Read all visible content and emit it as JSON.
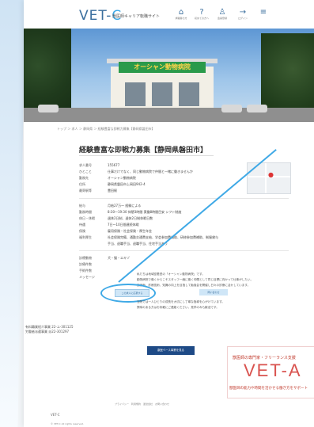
{
  "header": {
    "logo_main": "VET-",
    "logo_accent": "C",
    "logo_sub": "獣医師キャリア転職サイト",
    "nav": [
      {
        "glyph": "⌂",
        "label": "求職者の方"
      },
      {
        "glyph": "?",
        "label": "初めての方へ"
      },
      {
        "glyph": "♙",
        "label": "会員登録"
      },
      {
        "glyph": "→",
        "label": "ログイン"
      },
      {
        "glyph": "≡",
        "label": ""
      }
    ]
  },
  "hero": {
    "store_sign": "オーシャン動物病院"
  },
  "breadcrumb": "トップ ＞ 求人 ＞ 静岡県 ＞ 経験豊富な即戦力募集【静岡県磐田市】",
  "job": {
    "title": "経験豊富な即戦力募集【静岡県磐田市】",
    "info1": [
      {
        "key": "求人番号",
        "value": "155677"
      },
      {
        "key": "ひとこと",
        "value": "仕事だけでなく、同じ動物病院で仲間と一緒に働きませんか"
      },
      {
        "key": "勤務先",
        "value": "オーシャン動物病院"
      },
      {
        "key": "住所",
        "value": "静岡県磐田市上岡田942-4"
      },
      {
        "key": "最寄駅等",
        "value": "豊田駅"
      }
    ],
    "info2": [
      {
        "key": "給与",
        "value": "月給27万〜 経験による"
      },
      {
        "key": "勤務時間",
        "value": "8:30〜19:30 休憩3時間 実働8時間目安 シフト制度"
      },
      {
        "key": "休日・休暇",
        "value": "週休2日制、週休2日制休暇日数"
      },
      {
        "key": "待遇",
        "value": "7日〜10日間連続休暇"
      },
      {
        "key": "保険",
        "value": "雇用保険・社会保険・厚生年金"
      },
      {
        "key": "福利厚生",
        "value": "社会保険完備、通勤交通費支給、学会参加費補助、研修参加費補助、制服貸与"
      },
      {
        "key": "",
        "value": "手当、退職手当、退職手当、住宅手当あり"
      }
    ],
    "info3": [
      {
        "key": "診療動物",
        "value": "犬・猫・エキゾ"
      },
      {
        "key": "診療件数",
        "value": ""
      },
      {
        "key": "手術件数",
        "value": ""
      },
      {
        "key": "メッセージ",
        "value": ""
      }
    ],
    "message": [
      "私たちは地域密着型の「オーシャン動物病院」です。",
      "動物病院で働くからこそスタッフ一緒に働く仲間として同じ目標に向かって仕事がしたい。",
      "技術面、診療技術、知識の向上を目指して勉強会を開催し日々の診療に活かしています。",
      "当院では一人ひとりの成長を大切にし丁寧な指導を心がけています。",
      "興味のある方はお気軽にご連絡ください。見学のみも歓迎です。"
    ],
    "apply_button": "この求人に応募する",
    "detail_button": "問い合わせ"
  },
  "company": [
    "有料職業紹介事業 22-ユ-301125",
    "労働者派遣事業 派22-301297"
  ],
  "cta_button": "獣医ベース事業を見る",
  "banner": {
    "top_text": "獣医師の専門家・フリーランス支援",
    "logo": "VET-A",
    "bottom_text": "獣医師の能力や時間を活かせる働き方をサポート"
  },
  "footer": {
    "links": "プライバシー　利用規約　運営会社　お問い合わせ",
    "logo": "VET-C",
    "copy": "© VET-C All rights reserved."
  },
  "colors": {
    "brand": "#3b6f9e",
    "accent": "#3fa9e6",
    "cta": "#1e4a86",
    "banner_red": "#d9534f"
  }
}
